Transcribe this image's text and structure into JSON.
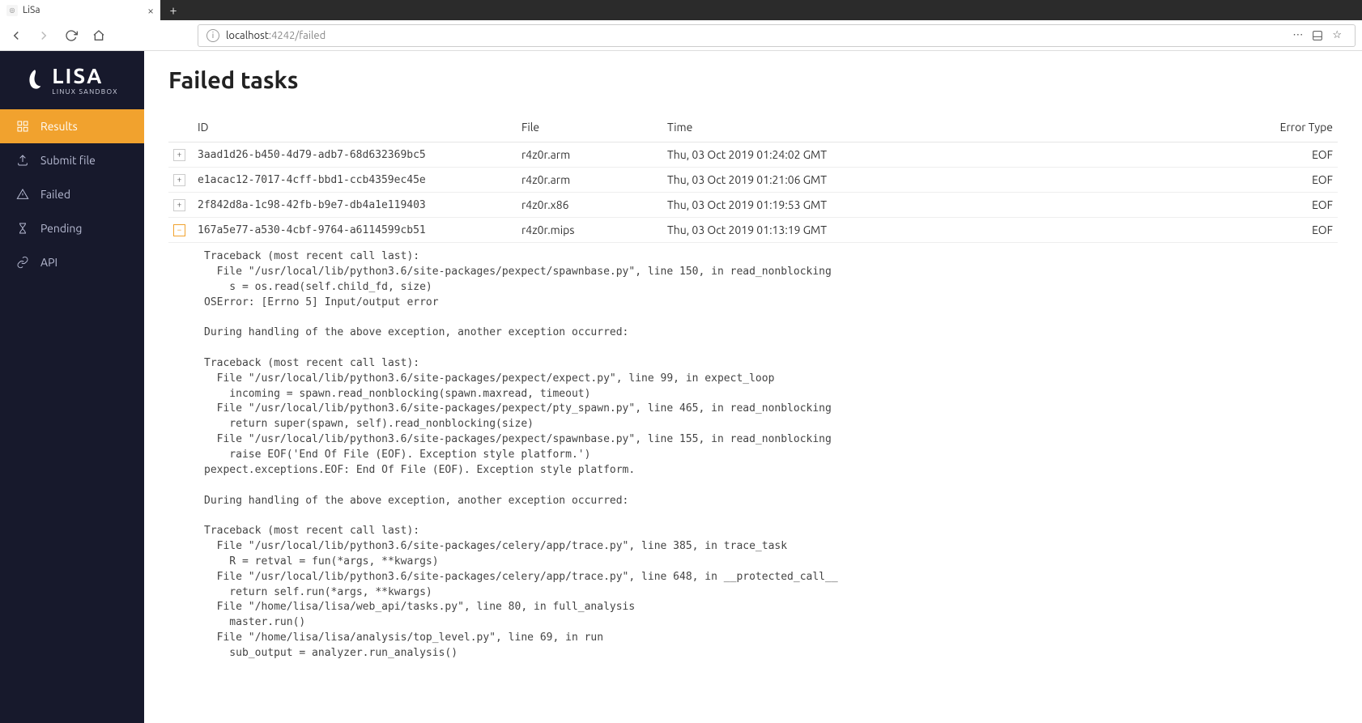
{
  "browser": {
    "tab_title": "LiSa",
    "url_info_symbol": "i",
    "url_host": "localhost",
    "url_path": ":4242/failed"
  },
  "brand": {
    "name": "LISA",
    "subtitle": "LINUX SANDBOX"
  },
  "sidebar": {
    "items": [
      {
        "label": "Results",
        "key": "results",
        "active": true
      },
      {
        "label": "Submit file",
        "key": "submit",
        "active": false
      },
      {
        "label": "Failed",
        "key": "failed",
        "active": false
      },
      {
        "label": "Pending",
        "key": "pending",
        "active": false
      },
      {
        "label": "API",
        "key": "api",
        "active": false
      }
    ]
  },
  "page": {
    "title": "Failed tasks",
    "columns": {
      "id": "ID",
      "file": "File",
      "time": "Time",
      "error_type": "Error Type"
    }
  },
  "tasks": [
    {
      "id": "3aad1d26-b450-4d79-adb7-68d632369bc5",
      "file": "r4z0r.arm",
      "time": "Thu, 03 Oct 2019 01:24:02 GMT",
      "error_type": "EOF",
      "expanded": false
    },
    {
      "id": "e1acac12-7017-4cff-bbd1-ccb4359ec45e",
      "file": "r4z0r.arm",
      "time": "Thu, 03 Oct 2019 01:21:06 GMT",
      "error_type": "EOF",
      "expanded": false
    },
    {
      "id": "2f842d8a-1c98-42fb-b9e7-db4a1e119403",
      "file": "r4z0r.x86",
      "time": "Thu, 03 Oct 2019 01:19:53 GMT",
      "error_type": "EOF",
      "expanded": false
    },
    {
      "id": "167a5e77-a530-4cbf-9764-a6114599cb51",
      "file": "r4z0r.mips",
      "time": "Thu, 03 Oct 2019 01:13:19 GMT",
      "error_type": "EOF",
      "expanded": true
    }
  ],
  "traceback": "Traceback (most recent call last):\n  File \"/usr/local/lib/python3.6/site-packages/pexpect/spawnbase.py\", line 150, in read_nonblocking\n    s = os.read(self.child_fd, size)\nOSError: [Errno 5] Input/output error\n\nDuring handling of the above exception, another exception occurred:\n\nTraceback (most recent call last):\n  File \"/usr/local/lib/python3.6/site-packages/pexpect/expect.py\", line 99, in expect_loop\n    incoming = spawn.read_nonblocking(spawn.maxread, timeout)\n  File \"/usr/local/lib/python3.6/site-packages/pexpect/pty_spawn.py\", line 465, in read_nonblocking\n    return super(spawn, self).read_nonblocking(size)\n  File \"/usr/local/lib/python3.6/site-packages/pexpect/spawnbase.py\", line 155, in read_nonblocking\n    raise EOF('End Of File (EOF). Exception style platform.')\npexpect.exceptions.EOF: End Of File (EOF). Exception style platform.\n\nDuring handling of the above exception, another exception occurred:\n\nTraceback (most recent call last):\n  File \"/usr/local/lib/python3.6/site-packages/celery/app/trace.py\", line 385, in trace_task\n    R = retval = fun(*args, **kwargs)\n  File \"/usr/local/lib/python3.6/site-packages/celery/app/trace.py\", line 648, in __protected_call__\n    return self.run(*args, **kwargs)\n  File \"/home/lisa/lisa/web_api/tasks.py\", line 80, in full_analysis\n    master.run()\n  File \"/home/lisa/lisa/analysis/top_level.py\", line 69, in run\n    sub_output = analyzer.run_analysis()"
}
